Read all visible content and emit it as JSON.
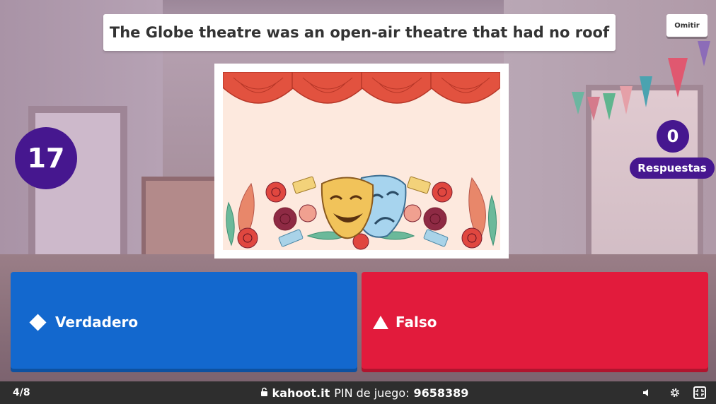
{
  "question": {
    "text": "The Globe theatre was an open-air theatre that had no roof"
  },
  "skip_button": {
    "label": "Omitir"
  },
  "timer": {
    "value": "17"
  },
  "answers_counter": {
    "count": "0",
    "label": "Respuestas"
  },
  "options": [
    {
      "label": "Verdadero",
      "shape": "diamond-icon",
      "color": "#1368ce"
    },
    {
      "label": "Falso",
      "shape": "triangle-icon",
      "color": "#e21b3c"
    }
  ],
  "bottom_bar": {
    "progress": "4/8",
    "site": "kahoot.it",
    "pin_label": "PIN de juego:",
    "pin": "9658389"
  },
  "colors": {
    "purple": "#46178f",
    "bar": "#2e2e2e"
  }
}
